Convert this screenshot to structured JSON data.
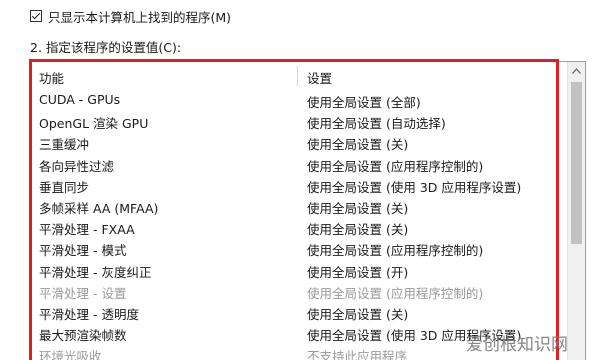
{
  "checkbox": {
    "label": "只显示本计算机上找到的程序(M)",
    "checked": true
  },
  "section_label": "2. 指定该程序的设置值(C):",
  "table": {
    "columns": [
      "功能",
      "设置"
    ],
    "rows": [
      {
        "feature": "CUDA - GPUs",
        "setting": "使用全局设置 (全部)",
        "disabled": false
      },
      {
        "feature": "OpenGL 渲染 GPU",
        "setting": "使用全局设置 (自动选择)",
        "disabled": false
      },
      {
        "feature": "三重缓冲",
        "setting": "使用全局设置 (关)",
        "disabled": false
      },
      {
        "feature": "各向异性过滤",
        "setting": "使用全局设置 (应用程序控制的)",
        "disabled": false
      },
      {
        "feature": "垂直同步",
        "setting": "使用全局设置 (使用 3D 应用程序设置)",
        "disabled": false
      },
      {
        "feature": "多帧采样 AA (MFAA)",
        "setting": "使用全局设置 (关)",
        "disabled": false
      },
      {
        "feature": "平滑处理 - FXAA",
        "setting": "使用全局设置 (关)",
        "disabled": false
      },
      {
        "feature": "平滑处理 - 模式",
        "setting": "使用全局设置 (应用程序控制的)",
        "disabled": false
      },
      {
        "feature": "平滑处理 - 灰度纠正",
        "setting": "使用全局设置 (开)",
        "disabled": false
      },
      {
        "feature": "平滑处理 - 设置",
        "setting": "使用全局设置 (应用程序控制的)",
        "disabled": true
      },
      {
        "feature": "平滑处理 - 透明度",
        "setting": "使用全局设置 (关)",
        "disabled": false
      },
      {
        "feature": "最大预渲染帧数",
        "setting": "使用全局设置 (使用 3D 应用程序设置)",
        "disabled": false
      },
      {
        "feature": "环境光吸收",
        "setting": "不支持此应用程序",
        "disabled": true
      }
    ]
  },
  "watermark": "爱创根知识网",
  "colors": {
    "highlight": "#e02020",
    "disabled_text": "#9a9a9a"
  },
  "icons": {
    "scroll_up": "chevron-up-icon"
  }
}
